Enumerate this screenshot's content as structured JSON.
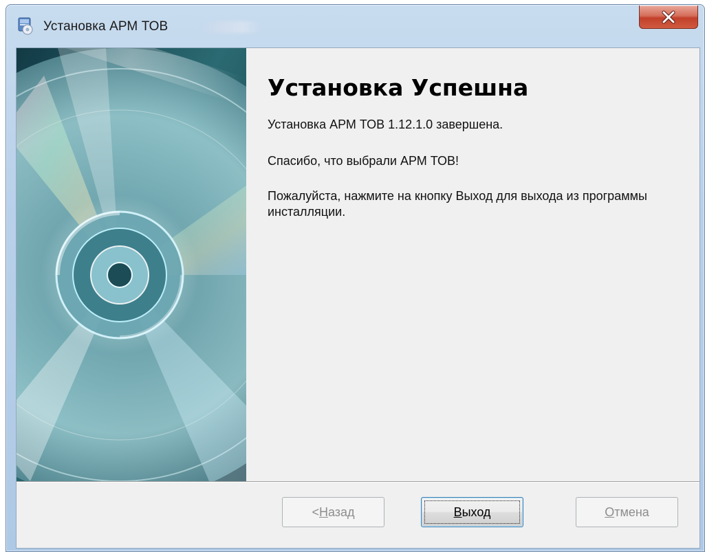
{
  "window": {
    "title": "Установка АРМ ТОВ",
    "close_symbol": "×",
    "close_color": "#c7422c",
    "frame_color": "#b9d1ea"
  },
  "content": {
    "heading": "Установка Успешна",
    "line1": "Установка АРМ ТОВ 1.12.1.0 завершена.",
    "line2": "Спасибо, что выбрали АРМ ТОВ!",
    "line3": "Пожалуйста, нажмите на кнопку Выход для выхода из программы инсталляции."
  },
  "buttons": {
    "back": {
      "prefix": "< ",
      "mnemonic": "Н",
      "rest": "азад",
      "enabled": false
    },
    "exit": {
      "mnemonic": "В",
      "rest": "ыход",
      "enabled": true,
      "default": true
    },
    "cancel": {
      "mnemonic": "О",
      "rest": "тмена",
      "enabled": false
    }
  },
  "icons": {
    "app": "installer-icon",
    "close": "close-icon",
    "banner": "cd-disc-image"
  }
}
